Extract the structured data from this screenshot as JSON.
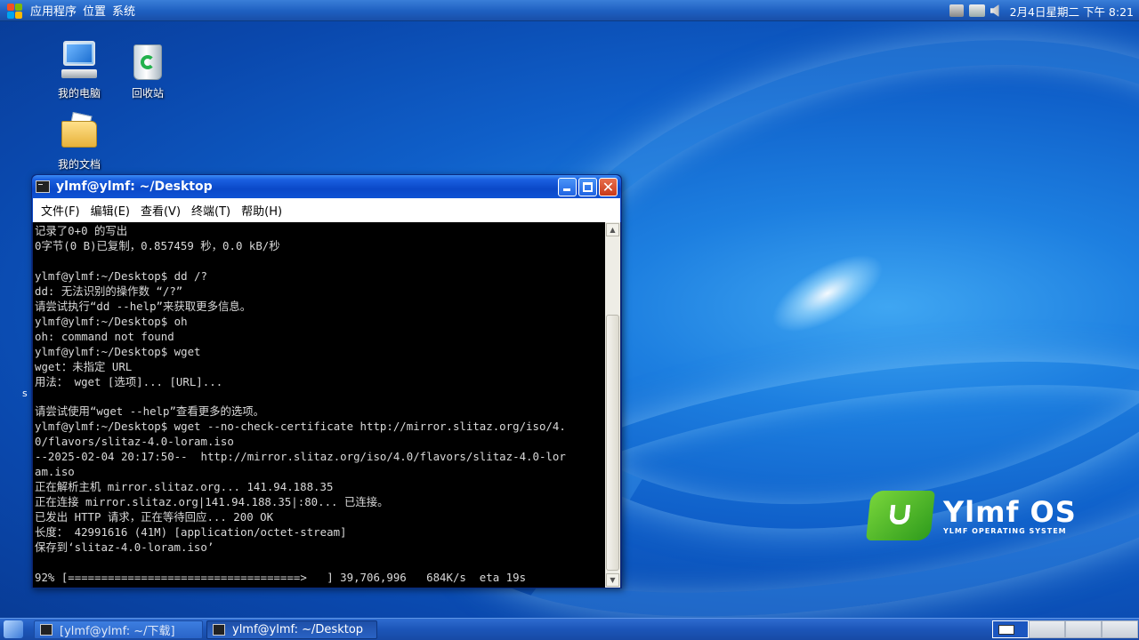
{
  "top_panel": {
    "menus": [
      "应用程序",
      "位置",
      "系统"
    ],
    "clock": "2月4日星期二 下午 8:21",
    "tray_icons": [
      "network-icon",
      "printer-icon",
      "volume-icon"
    ]
  },
  "desktop": {
    "icons": [
      {
        "label": "我的电脑",
        "icon": "computer-icon"
      },
      {
        "label": "回收站",
        "icon": "trash-icon"
      },
      {
        "label": "我的文档",
        "icon": "documents-folder-icon"
      }
    ],
    "stray_char": "s"
  },
  "terminal": {
    "title": "ylmf@ylmf: ~/Desktop",
    "menus": [
      "文件(F)",
      "编辑(E)",
      "查看(V)",
      "终端(T)",
      "帮助(H)"
    ],
    "lines": [
      "记录了0+0 的写出",
      "0字节(0 B)已复制，0.857459 秒，0.0 kB/秒",
      "",
      "ylmf@ylmf:~/Desktop$ dd /?",
      "dd: 无法识别的操作数 “/?”",
      "请尝试执行“dd --help”来获取更多信息。",
      "ylmf@ylmf:~/Desktop$ oh",
      "oh: command not found",
      "ylmf@ylmf:~/Desktop$ wget",
      "wget：未指定 URL",
      "用法： wget [选项]... [URL]...",
      "",
      "请尝试使用“wget --help”查看更多的选项。",
      "ylmf@ylmf:~/Desktop$ wget --no-check-certificate http://mirror.slitaz.org/iso/4.",
      "0/flavors/slitaz-4.0-loram.iso",
      "--2025-02-04 20:17:50--  http://mirror.slitaz.org/iso/4.0/flavors/slitaz-4.0-lor",
      "am.iso",
      "正在解析主机 mirror.slitaz.org... 141.94.188.35",
      "正在连接 mirror.slitaz.org|141.94.188.35|:80... 已连接。",
      "已发出 HTTP 请求，正在等待回应... 200 OK",
      "长度： 42991616 (41M) [application/octet-stream]",
      "保存到‘slitaz-4.0-loram.iso’",
      "",
      "92% [===================================>   ] 39,706,996   684K/s  eta 19s"
    ]
  },
  "logo": {
    "name": "Ylmf OS",
    "subtitle": "YLMF OPERATING SYSTEM"
  },
  "taskbar": {
    "items": [
      {
        "label": "[ylmf@ylmf: ~/下载]",
        "active": false
      },
      {
        "label": "ylmf@ylmf: ~/Desktop",
        "active": true
      }
    ],
    "workspaces": 4
  }
}
